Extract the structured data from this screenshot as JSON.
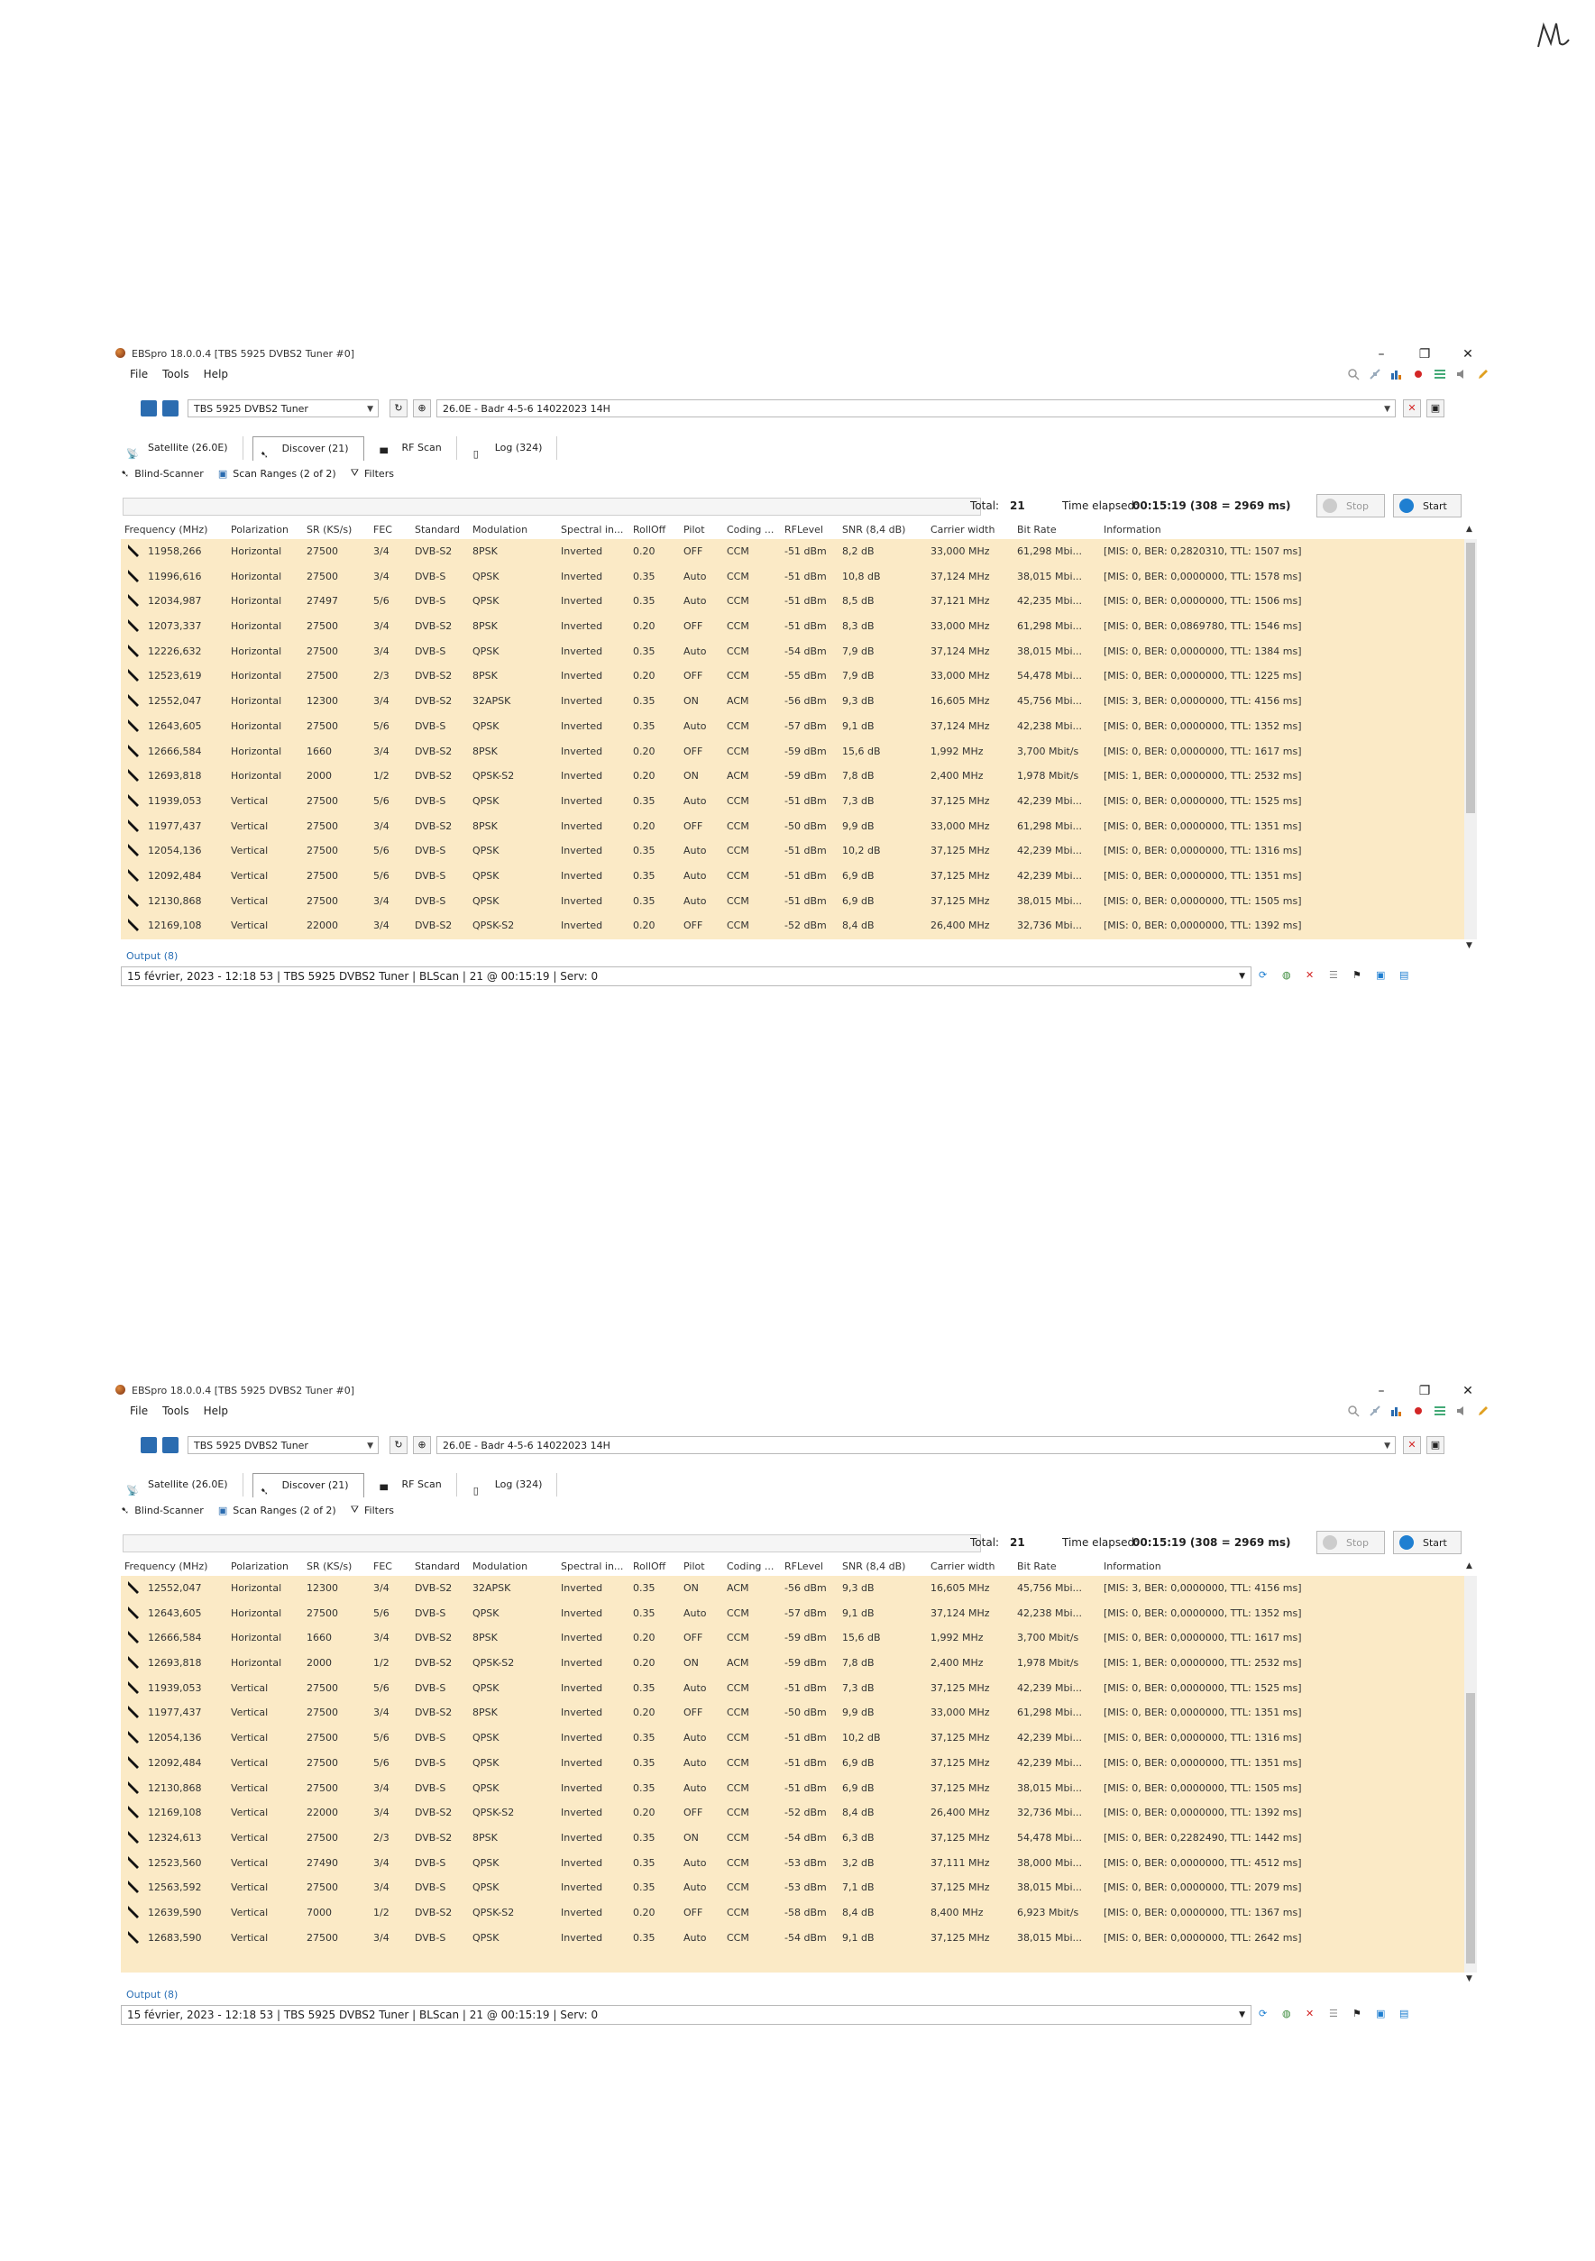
{
  "windows": [
    {
      "title": "EBSpro 18.0.0.4 [TBS 5925 DVBS2 Tuner #0]",
      "menu": [
        "File",
        "Tools",
        "Help"
      ],
      "tuner_select": "TBS 5925 DVBS2 Tuner",
      "satellite_select": "26.0E - Badr 4-5-6 14022023 14H",
      "tabs": [
        "Satellite (26.0E)",
        "Discover (21)",
        "RF Scan",
        "Log (324)"
      ],
      "subtools": [
        "Blind-Scanner",
        "Scan Ranges (2 of 2)",
        "Filters"
      ],
      "total_label": "Total:",
      "total_value": "21",
      "elapsed_label": "Time elapsed:",
      "elapsed_value": "00:15:19 (308 = 2969 ms)",
      "stop_label": "Stop",
      "start_label": "Start",
      "columns": [
        "Frequency (MHz)",
        "Polarization",
        "SR (KS/s)",
        "FEC",
        "Standard",
        "Modulation",
        "Spectral in...",
        "RollOff",
        "Pilot",
        "Coding ...",
        "RFLevel",
        "SNR (8,4 dB)",
        "Carrier width",
        "Bit Rate",
        "Information"
      ],
      "rows": [
        [
          "11958,266",
          "Horizontal",
          "27500",
          "3/4",
          "DVB-S2",
          "8PSK",
          "Inverted",
          "0.20",
          "OFF",
          "CCM",
          "-51 dBm",
          "8,2 dB",
          "33,000 MHz",
          "61,298 Mbi...",
          "[MIS: 0, BER: 0,2820310, TTL: 1507 ms]"
        ],
        [
          "11996,616",
          "Horizontal",
          "27500",
          "3/4",
          "DVB-S",
          "QPSK",
          "Inverted",
          "0.35",
          "Auto",
          "CCM",
          "-51 dBm",
          "10,8 dB",
          "37,124 MHz",
          "38,015 Mbi...",
          "[MIS: 0, BER: 0,0000000, TTL: 1578 ms]"
        ],
        [
          "12034,987",
          "Horizontal",
          "27497",
          "5/6",
          "DVB-S",
          "QPSK",
          "Inverted",
          "0.35",
          "Auto",
          "CCM",
          "-51 dBm",
          "8,5 dB",
          "37,121 MHz",
          "42,235 Mbi...",
          "[MIS: 0, BER: 0,0000000, TTL: 1506 ms]"
        ],
        [
          "12073,337",
          "Horizontal",
          "27500",
          "3/4",
          "DVB-S2",
          "8PSK",
          "Inverted",
          "0.20",
          "OFF",
          "CCM",
          "-51 dBm",
          "8,3 dB",
          "33,000 MHz",
          "61,298 Mbi...",
          "[MIS: 0, BER: 0,0869780, TTL: 1546 ms]"
        ],
        [
          "12226,632",
          "Horizontal",
          "27500",
          "3/4",
          "DVB-S",
          "QPSK",
          "Inverted",
          "0.35",
          "Auto",
          "CCM",
          "-54 dBm",
          "7,9 dB",
          "37,124 MHz",
          "38,015 Mbi...",
          "[MIS: 0, BER: 0,0000000, TTL: 1384 ms]"
        ],
        [
          "12523,619",
          "Horizontal",
          "27500",
          "2/3",
          "DVB-S2",
          "8PSK",
          "Inverted",
          "0.20",
          "OFF",
          "CCM",
          "-55 dBm",
          "7,9 dB",
          "33,000 MHz",
          "54,478 Mbi...",
          "[MIS: 0, BER: 0,0000000, TTL: 1225 ms]"
        ],
        [
          "12552,047",
          "Horizontal",
          "12300",
          "3/4",
          "DVB-S2",
          "32APSK",
          "Inverted",
          "0.35",
          "ON",
          "ACM",
          "-56 dBm",
          "9,3 dB",
          "16,605 MHz",
          "45,756 Mbi...",
          "[MIS: 3, BER: 0,0000000, TTL: 4156 ms]"
        ],
        [
          "12643,605",
          "Horizontal",
          "27500",
          "5/6",
          "DVB-S",
          "QPSK",
          "Inverted",
          "0.35",
          "Auto",
          "CCM",
          "-57 dBm",
          "9,1 dB",
          "37,124 MHz",
          "42,238 Mbi...",
          "[MIS: 0, BER: 0,0000000, TTL: 1352 ms]"
        ],
        [
          "12666,584",
          "Horizontal",
          "1660",
          "3/4",
          "DVB-S2",
          "8PSK",
          "Inverted",
          "0.20",
          "OFF",
          "CCM",
          "-59 dBm",
          "15,6 dB",
          "1,992 MHz",
          "3,700 Mbit/s",
          "[MIS: 0, BER: 0,0000000, TTL: 1617 ms]"
        ],
        [
          "12693,818",
          "Horizontal",
          "2000",
          "1/2",
          "DVB-S2",
          "QPSK-S2",
          "Inverted",
          "0.20",
          "ON",
          "ACM",
          "-59 dBm",
          "7,8 dB",
          "2,400 MHz",
          "1,978 Mbit/s",
          "[MIS: 1, BER: 0,0000000, TTL: 2532 ms]"
        ],
        [
          "11939,053",
          "Vertical",
          "27500",
          "5/6",
          "DVB-S",
          "QPSK",
          "Inverted",
          "0.35",
          "Auto",
          "CCM",
          "-51 dBm",
          "7,3 dB",
          "37,125 MHz",
          "42,239 Mbi...",
          "[MIS: 0, BER: 0,0000000, TTL: 1525 ms]"
        ],
        [
          "11977,437",
          "Vertical",
          "27500",
          "3/4",
          "DVB-S2",
          "8PSK",
          "Inverted",
          "0.20",
          "OFF",
          "CCM",
          "-50 dBm",
          "9,9 dB",
          "33,000 MHz",
          "61,298 Mbi...",
          "[MIS: 0, BER: 0,0000000, TTL: 1351 ms]"
        ],
        [
          "12054,136",
          "Vertical",
          "27500",
          "5/6",
          "DVB-S",
          "QPSK",
          "Inverted",
          "0.35",
          "Auto",
          "CCM",
          "-51 dBm",
          "10,2 dB",
          "37,125 MHz",
          "42,239 Mbi...",
          "[MIS: 0, BER: 0,0000000, TTL: 1316 ms]"
        ],
        [
          "12092,484",
          "Vertical",
          "27500",
          "5/6",
          "DVB-S",
          "QPSK",
          "Inverted",
          "0.35",
          "Auto",
          "CCM",
          "-51 dBm",
          "6,9 dB",
          "37,125 MHz",
          "42,239 Mbi...",
          "[MIS: 0, BER: 0,0000000, TTL: 1351 ms]"
        ],
        [
          "12130,868",
          "Vertical",
          "27500",
          "3/4",
          "DVB-S",
          "QPSK",
          "Inverted",
          "0.35",
          "Auto",
          "CCM",
          "-51 dBm",
          "6,9 dB",
          "37,125 MHz",
          "38,015 Mbi...",
          "[MIS: 0, BER: 0,0000000, TTL: 1505 ms]"
        ],
        [
          "12169,108",
          "Vertical",
          "22000",
          "3/4",
          "DVB-S2",
          "QPSK-S2",
          "Inverted",
          "0.20",
          "OFF",
          "CCM",
          "-52 dBm",
          "8,4 dB",
          "26,400 MHz",
          "32,736 Mbi...",
          "[MIS: 0, BER: 0,0000000, TTL: 1392 ms]"
        ]
      ],
      "output_label": "Output (8)",
      "status_text": "15 février, 2023 - 12:18 53 | TBS 5925 DVBS2 Tuner | BLScan | 21 @ 00:15:19 | Serv: 0"
    },
    {
      "title": "EBSpro 18.0.0.4 [TBS 5925 DVBS2 Tuner #0]",
      "menu": [
        "File",
        "Tools",
        "Help"
      ],
      "tuner_select": "TBS 5925 DVBS2 Tuner",
      "satellite_select": "26.0E - Badr 4-5-6 14022023 14H",
      "tabs": [
        "Satellite (26.0E)",
        "Discover (21)",
        "RF Scan",
        "Log (324)"
      ],
      "subtools": [
        "Blind-Scanner",
        "Scan Ranges (2 of 2)",
        "Filters"
      ],
      "total_label": "Total:",
      "total_value": "21",
      "elapsed_label": "Time elapsed:",
      "elapsed_value": "00:15:19 (308 = 2969 ms)",
      "stop_label": "Stop",
      "start_label": "Start",
      "columns": [
        "Frequency (MHz)",
        "Polarization",
        "SR (KS/s)",
        "FEC",
        "Standard",
        "Modulation",
        "Spectral in...",
        "RollOff",
        "Pilot",
        "Coding ...",
        "RFLevel",
        "SNR (8,4 dB)",
        "Carrier width",
        "Bit Rate",
        "Information"
      ],
      "rows": [
        [
          "12552,047",
          "Horizontal",
          "12300",
          "3/4",
          "DVB-S2",
          "32APSK",
          "Inverted",
          "0.35",
          "ON",
          "ACM",
          "-56 dBm",
          "9,3 dB",
          "16,605 MHz",
          "45,756 Mbi...",
          "[MIS: 3, BER: 0,0000000, TTL: 4156 ms]"
        ],
        [
          "12643,605",
          "Horizontal",
          "27500",
          "5/6",
          "DVB-S",
          "QPSK",
          "Inverted",
          "0.35",
          "Auto",
          "CCM",
          "-57 dBm",
          "9,1 dB",
          "37,124 MHz",
          "42,238 Mbi...",
          "[MIS: 0, BER: 0,0000000, TTL: 1352 ms]"
        ],
        [
          "12666,584",
          "Horizontal",
          "1660",
          "3/4",
          "DVB-S2",
          "8PSK",
          "Inverted",
          "0.20",
          "OFF",
          "CCM",
          "-59 dBm",
          "15,6 dB",
          "1,992 MHz",
          "3,700 Mbit/s",
          "[MIS: 0, BER: 0,0000000, TTL: 1617 ms]"
        ],
        [
          "12693,818",
          "Horizontal",
          "2000",
          "1/2",
          "DVB-S2",
          "QPSK-S2",
          "Inverted",
          "0.20",
          "ON",
          "ACM",
          "-59 dBm",
          "7,8 dB",
          "2,400 MHz",
          "1,978 Mbit/s",
          "[MIS: 1, BER: 0,0000000, TTL: 2532 ms]"
        ],
        [
          "11939,053",
          "Vertical",
          "27500",
          "5/6",
          "DVB-S",
          "QPSK",
          "Inverted",
          "0.35",
          "Auto",
          "CCM",
          "-51 dBm",
          "7,3 dB",
          "37,125 MHz",
          "42,239 Mbi...",
          "[MIS: 0, BER: 0,0000000, TTL: 1525 ms]"
        ],
        [
          "11977,437",
          "Vertical",
          "27500",
          "3/4",
          "DVB-S2",
          "8PSK",
          "Inverted",
          "0.20",
          "OFF",
          "CCM",
          "-50 dBm",
          "9,9 dB",
          "33,000 MHz",
          "61,298 Mbi...",
          "[MIS: 0, BER: 0,0000000, TTL: 1351 ms]"
        ],
        [
          "12054,136",
          "Vertical",
          "27500",
          "5/6",
          "DVB-S",
          "QPSK",
          "Inverted",
          "0.35",
          "Auto",
          "CCM",
          "-51 dBm",
          "10,2 dB",
          "37,125 MHz",
          "42,239 Mbi...",
          "[MIS: 0, BER: 0,0000000, TTL: 1316 ms]"
        ],
        [
          "12092,484",
          "Vertical",
          "27500",
          "5/6",
          "DVB-S",
          "QPSK",
          "Inverted",
          "0.35",
          "Auto",
          "CCM",
          "-51 dBm",
          "6,9 dB",
          "37,125 MHz",
          "42,239 Mbi...",
          "[MIS: 0, BER: 0,0000000, TTL: 1351 ms]"
        ],
        [
          "12130,868",
          "Vertical",
          "27500",
          "3/4",
          "DVB-S",
          "QPSK",
          "Inverted",
          "0.35",
          "Auto",
          "CCM",
          "-51 dBm",
          "6,9 dB",
          "37,125 MHz",
          "38,015 Mbi...",
          "[MIS: 0, BER: 0,0000000, TTL: 1505 ms]"
        ],
        [
          "12169,108",
          "Vertical",
          "22000",
          "3/4",
          "DVB-S2",
          "QPSK-S2",
          "Inverted",
          "0.20",
          "OFF",
          "CCM",
          "-52 dBm",
          "8,4 dB",
          "26,400 MHz",
          "32,736 Mbi...",
          "[MIS: 0, BER: 0,0000000, TTL: 1392 ms]"
        ],
        [
          "12324,613",
          "Vertical",
          "27500",
          "2/3",
          "DVB-S2",
          "8PSK",
          "Inverted",
          "0.35",
          "ON",
          "CCM",
          "-54 dBm",
          "6,3 dB",
          "37,125 MHz",
          "54,478 Mbi...",
          "[MIS: 0, BER: 0,2282490, TTL: 1442 ms]"
        ],
        [
          "12523,560",
          "Vertical",
          "27490",
          "3/4",
          "DVB-S",
          "QPSK",
          "Inverted",
          "0.35",
          "Auto",
          "CCM",
          "-53 dBm",
          "3,2 dB",
          "37,111 MHz",
          "38,000 Mbi...",
          "[MIS: 0, BER: 0,0000000, TTL: 4512 ms]"
        ],
        [
          "12563,592",
          "Vertical",
          "27500",
          "3/4",
          "DVB-S",
          "QPSK",
          "Inverted",
          "0.35",
          "Auto",
          "CCM",
          "-53 dBm",
          "7,1 dB",
          "37,125 MHz",
          "38,015 Mbi...",
          "[MIS: 0, BER: 0,0000000, TTL: 2079 ms]"
        ],
        [
          "12639,590",
          "Vertical",
          "7000",
          "1/2",
          "DVB-S2",
          "QPSK-S2",
          "Inverted",
          "0.20",
          "OFF",
          "CCM",
          "-58 dBm",
          "8,4 dB",
          "8,400 MHz",
          "6,923 Mbit/s",
          "[MIS: 0, BER: 0,0000000, TTL: 1367 ms]"
        ],
        [
          "12683,590",
          "Vertical",
          "27500",
          "3/4",
          "DVB-S",
          "QPSK",
          "Inverted",
          "0.35",
          "Auto",
          "CCM",
          "-54 dBm",
          "9,1 dB",
          "37,125 MHz",
          "38,015 Mbi...",
          "[MIS: 0, BER: 0,0000000, TTL: 2642 ms]"
        ]
      ],
      "output_label": "Output (8)",
      "status_text": "15 février, 2023 - 12:18 53 | TBS 5925 DVBS2 Tuner | BLScan | 21 @ 00:15:19 | Serv: 0"
    }
  ],
  "colors": {
    "grid_background": "#fbeac6",
    "link_blue": "#2a6fb5",
    "start_blue": "#1f7fd1",
    "close_red": "#d32626"
  },
  "icons": [
    "satellite-dish-icon",
    "info-icon",
    "lock-icon",
    "refresh-icon",
    "satellite-icon",
    "close-icon",
    "save-icon",
    "flag-icon",
    "globe-icon"
  ]
}
